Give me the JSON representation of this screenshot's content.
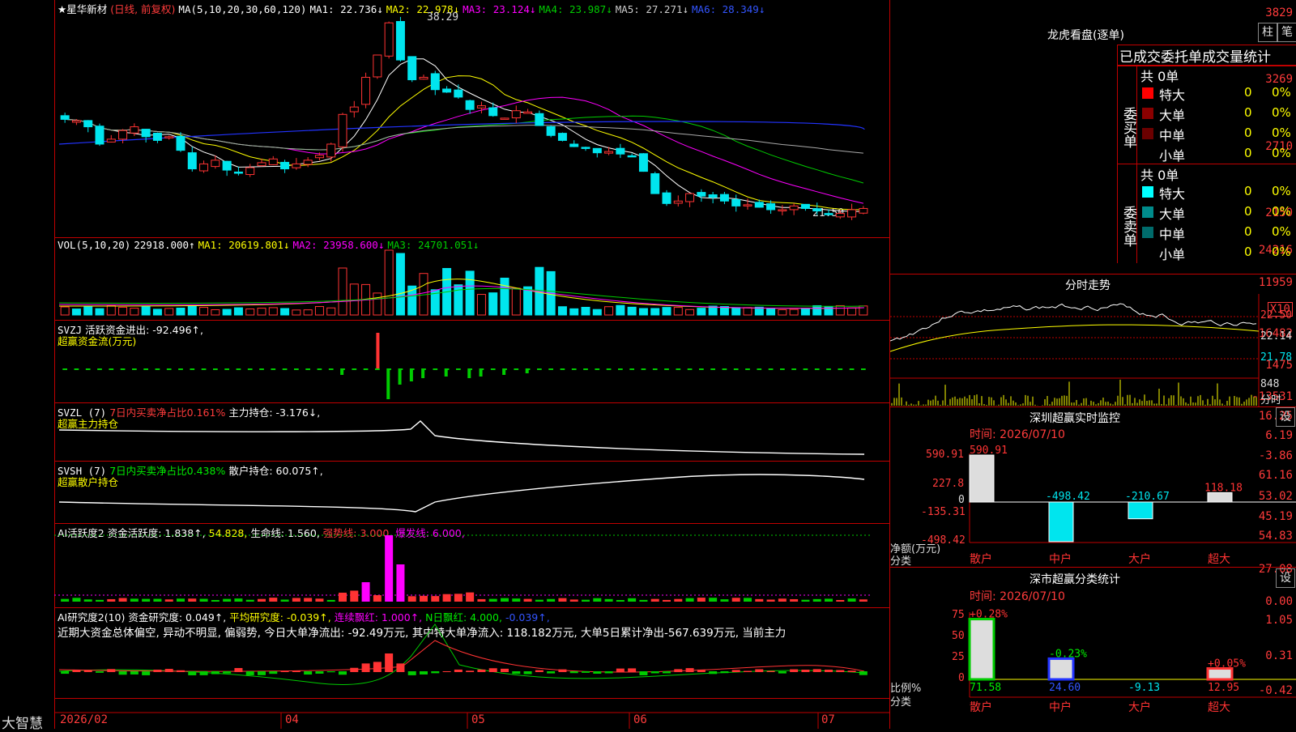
{
  "colors": {
    "up": "#ff3333",
    "down": "#00e5ee",
    "grid": "#c00000",
    "ma1": "#ffffff",
    "ma2": "#ffff00",
    "ma3": "#ff00ff",
    "ma4": "#00cc00",
    "ma5": "#aaaaaa",
    "ma6": "#2233ff"
  },
  "main": {
    "title": "★星华新材",
    "mode": "(日线, 前复权)",
    "ma_label": "MA(5,10,20,30,60,120)",
    "ma": [
      "MA1: 22.736↓",
      "MA2: 22.978↓",
      "MA3: 23.124↓",
      "MA4: 23.987↓",
      "MA5: 27.271↓",
      "MA6: 28.349↓"
    ],
    "y_ticks": [
      "3829",
      "3269",
      "2710",
      "2150"
    ],
    "peak_label": "38.29",
    "low_label": "21.50"
  },
  "vol": {
    "label": "VOL(5,10,20)",
    "v": "22918.000↑",
    "ma": [
      "MA1: 20619.801↓",
      "MA2: 23958.600↓",
      "MA3: 24701.051↓"
    ],
    "y_ticks": [
      "24216",
      "11959",
      "X10"
    ]
  },
  "svzj": {
    "label": "SVZJ",
    "t1": "活跃资金进出: -92.496↑,",
    "t2": "超赢资金流(万元)",
    "y_ticks": [
      "16482",
      "1475",
      "-13531"
    ]
  },
  "svzl": {
    "label": "SVZL (7)",
    "t1": "7日内买卖净占比0.161%",
    "t2": "主力持仓: -3.176↓,",
    "t3": "超赢主力持仓",
    "y_ticks": [
      "16.25",
      "6.19",
      "-3.86"
    ]
  },
  "svsh": {
    "label": "SVSH (7)",
    "t1": "7日内买卖净占比0.438%",
    "t2": "散户持仓: 60.075↑,",
    "t3": "超赢散户持仓",
    "y_ticks": [
      "61.16",
      "53.02",
      "45.19"
    ]
  },
  "ai1": {
    "label": "AI活跃度2",
    "t1": "资金活跃度: 1.838↑,",
    "t2": "54.828,",
    "t3": "生命线: 1.560,",
    "t4": "强势线: 3.000,",
    "t5": "爆发线: 6.000,",
    "y_ticks": [
      "54.83",
      "27.08",
      "0.00"
    ]
  },
  "ai2": {
    "label": "AI研究度2(10)",
    "t1": "资金研究度: 0.049↑,",
    "t2": "平均研究度: -0.039↑,",
    "t3": "连续飘红: 1.000↑,",
    "t4": "N日飘红: 4.000,",
    "t5": "-0.039↑,",
    "desc": "近期大资金总体偏空, 异动不明显, 偏弱势, 今日大单净流出: -92.49万元, 其中特大单净流入: 118.182万元, 大单5日累计净出-567.639万元, 当前主力",
    "y_ticks": [
      "1.05",
      "0.31",
      "-0.42"
    ]
  },
  "xaxis": {
    "dates": [
      "2026/02",
      "04",
      "05",
      "06",
      "07"
    ],
    "brand": "大智慧"
  },
  "dragon": {
    "title": "龙虎看盘(逐单)",
    "btn1": "柱",
    "btn2": "笔",
    "subtitle": "已成交委托单成交量统计",
    "buy": {
      "side": "委买单",
      "total": "共 0单",
      "rows": [
        {
          "name": "特大",
          "v": "0",
          "p": "0%",
          "c": "#ff0000"
        },
        {
          "name": "大单",
          "v": "0",
          "p": "0%",
          "c": "#8b0000"
        },
        {
          "name": "中单",
          "v": "0",
          "p": "0%",
          "c": "#6b0000"
        },
        {
          "name": "小单",
          "v": "0",
          "p": "0%",
          "c": "#000000"
        }
      ]
    },
    "sell": {
      "side": "委卖单",
      "total": "共 0单",
      "rows": [
        {
          "name": "特大",
          "v": "0",
          "p": "0%",
          "c": "#00ffff"
        },
        {
          "name": "大单",
          "v": "0",
          "p": "0%",
          "c": "#008b8b"
        },
        {
          "name": "中单",
          "v": "0",
          "p": "0%",
          "c": "#006b6b"
        },
        {
          "name": "小单",
          "v": "0",
          "p": "0%",
          "c": "#000000"
        }
      ]
    }
  },
  "intraday": {
    "title": "分时走势",
    "y_ticks": [
      "22.50",
      "22.14",
      "21.78"
    ],
    "vol": "848",
    "unit": "分时"
  },
  "sz_monitor": {
    "title": "深圳超赢实时监控",
    "btn": "设",
    "time": "时间: 2026/07/10",
    "y_ticks": [
      "590.91",
      "227.8",
      "0",
      "-135.31",
      "-498.42"
    ],
    "unit1": "净额(万元)",
    "unit2": "分类",
    "categories": [
      "散户",
      "中户",
      "大户",
      "超大"
    ],
    "values": [
      590.91,
      -498.42,
      -210.67,
      118.18
    ],
    "value_labels": [
      "590.91",
      "-498.42",
      "-210.67",
      "118.18"
    ]
  },
  "sz_stat": {
    "title": "深市超赢分类统计",
    "btn": "设",
    "time": "时间: 2026/07/10",
    "y_ticks": [
      "75",
      "50",
      "25",
      "0"
    ],
    "unit1": "比例%",
    "unit2": "分类",
    "categories": [
      "散户",
      "中户",
      "大户",
      "超大"
    ],
    "bars": [
      71.58,
      24.6,
      0,
      12.95
    ],
    "top_labels": [
      "+0.28%",
      "-0.23%",
      "",
      "+0.05%"
    ],
    "bottom_labels": [
      "71.58",
      "24.60",
      "-9.13",
      "12.95"
    ]
  }
}
